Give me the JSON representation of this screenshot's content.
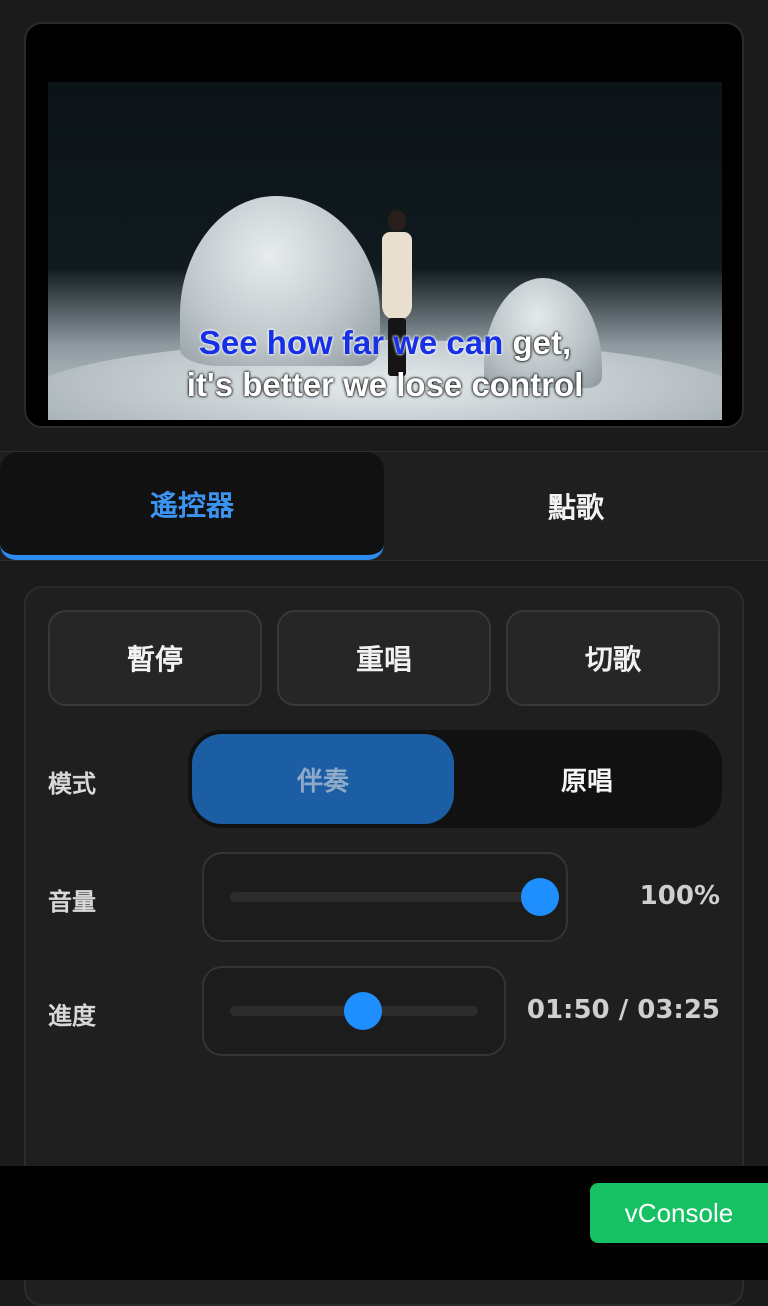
{
  "player": {
    "lyrics": {
      "line1_sung": "See how far we can",
      "line1_rest": " get,",
      "line2": "it's better we lose control"
    }
  },
  "tabs": [
    {
      "label": "遙控器",
      "active": true
    },
    {
      "label": "點歌",
      "active": false
    }
  ],
  "controls": {
    "pause_label": "暫停",
    "replay_label": "重唱",
    "skip_label": "切歌",
    "mode": {
      "label": "模式",
      "options": [
        "伴奏",
        "原唱"
      ],
      "selected": "伴奏"
    },
    "volume": {
      "label": "音量",
      "value_text": "100%",
      "fraction": 1.0
    },
    "progress": {
      "label": "進度",
      "value_text": "01:50 / 03:25",
      "fraction": 0.537
    }
  },
  "vconsole_label": "vConsole",
  "colors": {
    "accent": "#1f8fff",
    "tab_active_text": "#3b93f2",
    "mode_selected": "#1b5ea3",
    "sung_lyric": "#1630e6",
    "vconsole": "#15c162"
  }
}
